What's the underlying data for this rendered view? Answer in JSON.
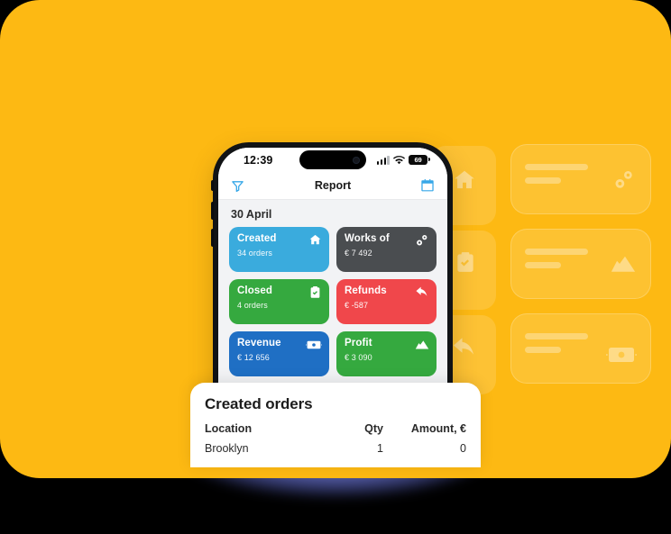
{
  "theme": {
    "background_yellow": "#FDB913",
    "page_background": "#000000",
    "accent_blue": "#36a7e8",
    "glow_color": "#5b63b0"
  },
  "phone": {
    "status_bar": {
      "time": "12:39",
      "battery_level": "69",
      "signal_icon": "signal-bars-icon",
      "wifi_icon": "wifi-icon",
      "battery_icon": "battery-icon"
    },
    "nav_bar": {
      "title": "Report",
      "left_icon": "filter-funnel-icon",
      "right_icon": "calendar-icon"
    },
    "report": {
      "date_label": "30 April",
      "cards": [
        {
          "title": "Created",
          "value": "34 orders",
          "color": "#3aabdd",
          "icon": "home-icon"
        },
        {
          "title": "Works of",
          "value": "€ 7 492",
          "color": "#4a4d50",
          "icon": "gears-icon"
        },
        {
          "title": "Closed",
          "value": "4 orders",
          "color": "#35a93f",
          "icon": "clipboard-check-icon"
        },
        {
          "title": "Refunds",
          "value": "€ -587",
          "color": "#f0474b",
          "icon": "reply-arrow-icon"
        },
        {
          "title": "Revenue",
          "value": "€ 12 656",
          "color": "#1f6fc4",
          "icon": "banknote-icon"
        },
        {
          "title": "Profit",
          "value": "€ 3 090",
          "color": "#35a93f",
          "icon": "mountain-chart-icon"
        }
      ]
    }
  },
  "sheet": {
    "title": "Created orders",
    "columns": [
      "Location",
      "Qty",
      "Amount, €"
    ],
    "rows": [
      {
        "location": "Brooklyn",
        "qty": "1",
        "amount": "0"
      }
    ]
  },
  "background_cards": {
    "square_icons": [
      "home-icon",
      "clipboard-check-icon",
      "reply-arrow-icon"
    ],
    "wide_icons": [
      "gears-icon",
      "mountain-chart-icon",
      "banknote-icon"
    ]
  }
}
